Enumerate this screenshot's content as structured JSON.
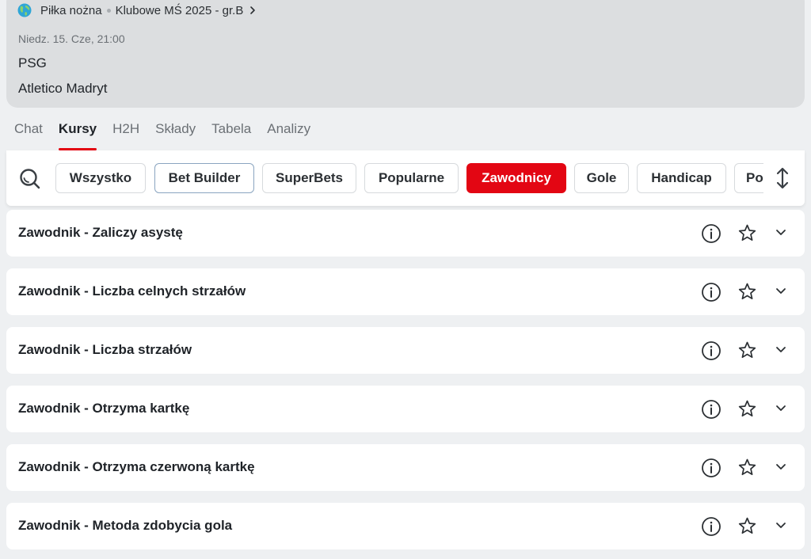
{
  "breadcrumb": {
    "sport": "Piłka nożna",
    "league": "Klubowe MŚ 2025 - gr.B"
  },
  "match": {
    "datetime": "Niedz. 15. Cze, 21:00",
    "home": "PSG",
    "away": "Atletico Madryt"
  },
  "tabs": [
    {
      "label": "Chat",
      "active": false
    },
    {
      "label": "Kursy",
      "active": true
    },
    {
      "label": "H2H",
      "active": false
    },
    {
      "label": "Składy",
      "active": false
    },
    {
      "label": "Tabela",
      "active": false
    },
    {
      "label": "Analizy",
      "active": false
    }
  ],
  "filters": [
    {
      "label": "Wszystko"
    },
    {
      "label": "Bet Builder"
    },
    {
      "label": "SuperBets"
    },
    {
      "label": "Popularne"
    },
    {
      "label": "Zawodnicy",
      "active": true
    },
    {
      "label": "Gole"
    },
    {
      "label": "Handicap"
    },
    {
      "label": "Po"
    }
  ],
  "markets": [
    {
      "title": "Zawodnik - Zaliczy asystę"
    },
    {
      "title": "Zawodnik - Liczba celnych strzałów"
    },
    {
      "title": "Zawodnik - Liczba strzałów"
    },
    {
      "title": "Zawodnik - Otrzyma kartkę"
    },
    {
      "title": "Zawodnik - Otrzyma czerwoną kartkę"
    },
    {
      "title": "Zawodnik - Metoda zdobycia gola"
    }
  ],
  "icons": {
    "sport": "globe-icon",
    "breadcrumb_next": "chevron-right-icon",
    "search": "search-icon",
    "sort": "sort-arrows-icon",
    "info": "info-icon",
    "favorite": "star-icon",
    "expand": "chevron-down-icon"
  },
  "colors": {
    "accent": "#e30613",
    "background": "#eef0f2",
    "header": "#dcdee0"
  }
}
